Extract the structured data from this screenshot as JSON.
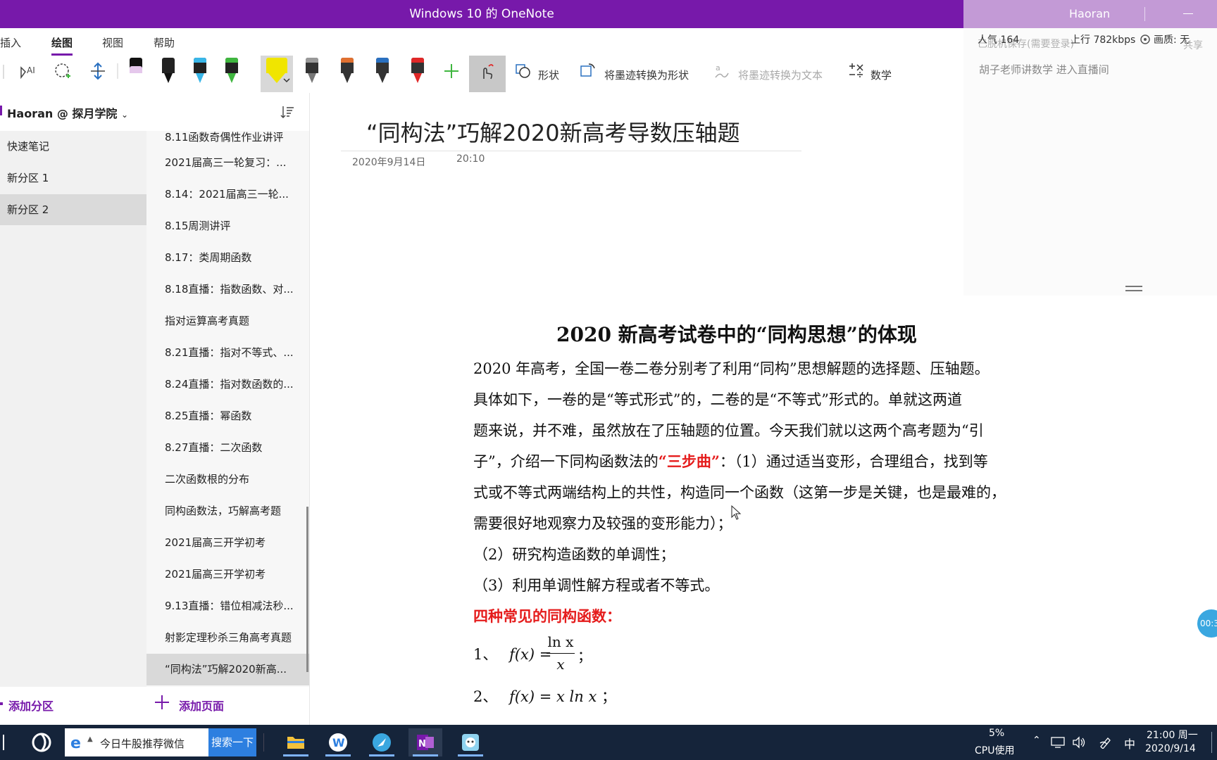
{
  "window": {
    "title": "Windows 10 的 OneNote",
    "user": "Haoran"
  },
  "ribbon": {
    "tabs": [
      "插入",
      "绘图",
      "视图",
      "帮助"
    ],
    "active_tab": "绘图",
    "pens": [
      {
        "body": "#111111",
        "tip": "#d8b0e0",
        "color": "#c070d0"
      },
      {
        "body": "#222222",
        "tip": "#111111",
        "color": "#111111"
      },
      {
        "body": "#222222",
        "tip": "#39b6e8",
        "color": "#39b6e8"
      },
      {
        "body": "#222222",
        "tip": "#3fb63f",
        "color": "#3fb63f"
      },
      {
        "body": "#f0e500",
        "tip": "#f0e500",
        "color": "#f0e500"
      },
      {
        "body": "#333333",
        "tip": "#999999",
        "color": "#999999"
      },
      {
        "body": "#333333",
        "tip": "#e07030",
        "color": "#e07030"
      },
      {
        "body": "#333333",
        "tip": "#2a70c0",
        "color": "#2a70c0"
      },
      {
        "body": "#333333",
        "tip": "#e02828",
        "color": "#e02828"
      }
    ],
    "shapes_label": "形状",
    "ink_to_shape_label": "将墨迹转换为形状",
    "ink_to_text_label": "将墨迹转换为文本",
    "math_label": "数学"
  },
  "live": {
    "popularity": "人气 164",
    "upload": "上行 782kbps",
    "quality": "画质: 无",
    "ghost_save": "已脱机保存(需要登录)",
    "ghost_share": "共享",
    "channel": "胡子老师讲数学 进入直播间",
    "timer": "00:3"
  },
  "notebook": {
    "name": "Haoran @ 探月学院"
  },
  "sections": [
    {
      "label": "快速笔记"
    },
    {
      "label": "新分区 1"
    },
    {
      "label": "新分区 2"
    }
  ],
  "pages": [
    {
      "label": "8.11函数奇偶性作业讲评"
    },
    {
      "label": "2021届高三一轮复习：..."
    },
    {
      "label": "8.14：2021届高三一轮..."
    },
    {
      "label": "8.15周测讲评"
    },
    {
      "label": "8.17：类周期函数"
    },
    {
      "label": "8.18直播：指数函数、对..."
    },
    {
      "label": "指对运算高考真题"
    },
    {
      "label": "8.21直播：指对不等式、..."
    },
    {
      "label": "8.24直播：指对数函数的..."
    },
    {
      "label": "8.25直播：幂函数"
    },
    {
      "label": "8.27直播：二次函数"
    },
    {
      "label": "二次函数根的分布"
    },
    {
      "label": "同构函数法，巧解高考题"
    },
    {
      "label": "2021届高三开学初考"
    },
    {
      "label": "2021届高三开学初考"
    },
    {
      "label": "9.13直播：错位相减法秒..."
    },
    {
      "label": "射影定理秒杀三角高考真题"
    },
    {
      "label": "“同构法”巧解2020新高..."
    }
  ],
  "add_section_label": "添加分区",
  "add_page_label": "添加页面",
  "note": {
    "title": "“同构法”巧解2020新高考导数压轴题",
    "date": "2020年9月14日",
    "time": "20:10",
    "heading": "2020 新高考试卷中的“同构思想”的体现",
    "para_lines": [
      "2020 年高考，全国一卷二卷分别考了利用“同构”思想解题的选择题、压轴题。",
      "具体如下，一卷的是“等式形式”的，二卷的是“不等式”形式的。单就这两道",
      "题来说，并不难，虽然放在了压轴题的位置。今天我们就以这两个高考题为“引",
      "子”，介绍一下同构函数法的",
      "“三步曲”",
      "：（1）通过适当变形，合理组合，找到等",
      "式或不等式两端结构上的共性，构造同一个函数（这第一步是关键，也是最难的，",
      "需要很好地观察力及较强的变形能力）；",
      "（2）研究构造函数的单调性；",
      "（3）利用单调性解方程或者不等式。"
    ],
    "four_functions": "四种常见的同构函数：",
    "f1_prefix": "1、",
    "f1_lhs": "f(x) =",
    "f1_num": "ln x",
    "f1_den": "x",
    "f1_end": "；",
    "f2_prefix": "2、",
    "f2_expr": "f(x) = x ln x",
    "f2_end": "；"
  },
  "taskbar": {
    "search_text": "今日牛股推荐微信",
    "search_button": "搜索一下",
    "cpu_percent": "5%",
    "cpu_label": "CPU使用",
    "ime": "中",
    "time": "21:00 周一",
    "date": "2020/9/14"
  }
}
